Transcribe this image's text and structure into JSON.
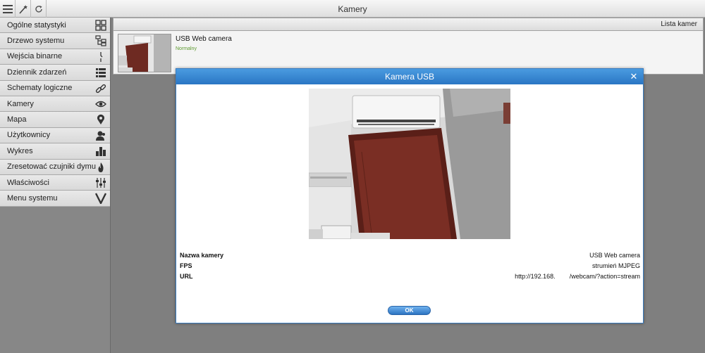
{
  "app": {
    "title": "Kamery"
  },
  "toolbar": {
    "menu_icon": "hamburger-icon",
    "wand_icon": "magic-wand-icon",
    "refresh_icon": "refresh-icon"
  },
  "sidebar": {
    "items": [
      {
        "label": "Ogólne statystyki",
        "icon": "dashboard-grid-icon"
      },
      {
        "label": "Drzewo systemu",
        "icon": "tree-icon"
      },
      {
        "label": "Wejścia binarne",
        "icon": "binary-input-icon"
      },
      {
        "label": "Dziennik zdarzeń",
        "icon": "list-icon"
      },
      {
        "label": "Schematy logiczne",
        "icon": "link-icon"
      },
      {
        "label": "Kamery",
        "icon": "eye-icon"
      },
      {
        "label": "Mapa",
        "icon": "map-pin-icon"
      },
      {
        "label": "Użytkownicy",
        "icon": "users-icon"
      },
      {
        "label": "Wykres",
        "icon": "bar-chart-icon"
      },
      {
        "label": "Zresetować czujniki dymu",
        "icon": "flame-icon"
      },
      {
        "label": "Właściwości",
        "icon": "sliders-icon"
      },
      {
        "label": "Menu systemu",
        "icon": "v-logo-icon"
      }
    ]
  },
  "camera_list": {
    "header": "Lista kamer",
    "cameras": [
      {
        "name": "USB Web camera",
        "status": "Normalny"
      }
    ]
  },
  "modal": {
    "title": "Kamera USB",
    "close_icon": "close-icon",
    "fields": [
      {
        "label": "Nazwa kamery",
        "value": "USB Web camera"
      },
      {
        "label": "FPS",
        "value": "strumień MJPEG"
      },
      {
        "label": "URL",
        "value": "http://192.168.        /webcam/?action=stream"
      }
    ],
    "ok_label": "OK"
  },
  "colors": {
    "accent": "#2a76c4",
    "status_ok": "#5c9a2e",
    "door": "#6e2a22"
  }
}
